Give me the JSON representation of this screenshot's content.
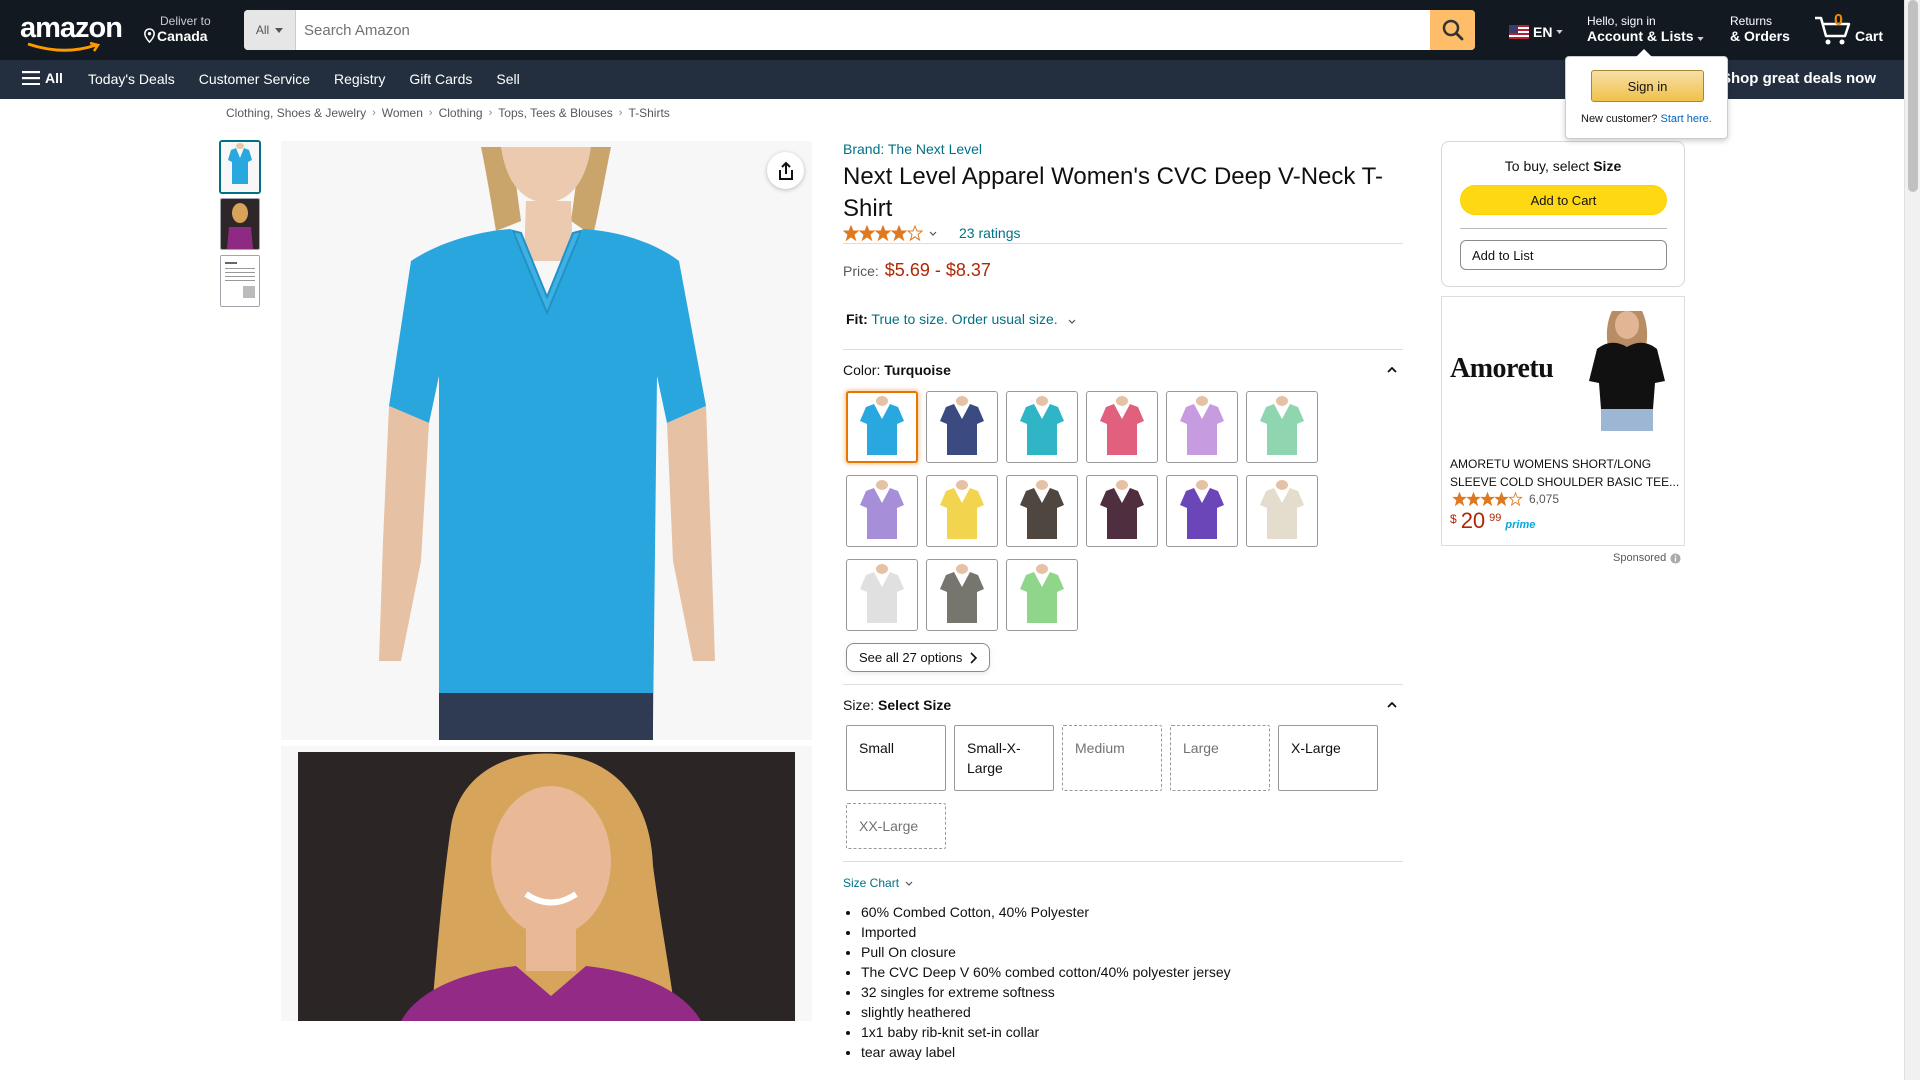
{
  "header": {
    "logo_text": "amazon",
    "deliver_line1": "Deliver to",
    "deliver_line2": "Canada",
    "search_category": "All",
    "search_placeholder": "Search Amazon",
    "language": "EN",
    "account_line1": "Hello, sign in",
    "account_line2": "Account & Lists",
    "returns_line1": "Returns",
    "returns_line2": "& Orders",
    "cart_count": "0",
    "cart_label": "Cart"
  },
  "nav": {
    "all_label": "All",
    "links": [
      "Today's Deals",
      "Customer Service",
      "Registry",
      "Gift Cards",
      "Sell"
    ],
    "promo": "Shop great deals now"
  },
  "flyout": {
    "signin_label": "Sign in",
    "new_customer": "New customer?",
    "start_here": "Start here."
  },
  "breadcrumb": [
    "Clothing, Shoes & Jewelry",
    "Women",
    "Clothing",
    "Tops, Tees & Blouses",
    "T-Shirts"
  ],
  "product": {
    "brand": "Brand: The Next Level",
    "title": "Next Level Apparel Women's CVC Deep V-Neck T-Shirt",
    "ratings": "23 ratings",
    "rating_stars": 4.0,
    "price_label": "Price:",
    "price": "$5.69 - $8.37",
    "fit_label": "Fit:",
    "fit_value": "True to size. Order usual size.",
    "color_label": "Color:",
    "color_value": "Turquoise",
    "colors": [
      "#29a8e0",
      "#3b4b82",
      "#2fb5c6",
      "#e0607e",
      "#c69be0",
      "#8fd6b0",
      "#a68fd8",
      "#f2d44f",
      "#4f4640",
      "#4f2f3f",
      "#6b46b8",
      "#e4dccd",
      "#e0e0e0",
      "#76766e",
      "#8fd68a"
    ],
    "see_all": "See all 27 options",
    "size_label": "Size:",
    "size_value": "Select Size",
    "sizes": [
      {
        "label": "Small",
        "available": true
      },
      {
        "label": "Small-X-Large",
        "available": true
      },
      {
        "label": "Medium",
        "available": false
      },
      {
        "label": "Large",
        "available": false
      },
      {
        "label": "X-Large",
        "available": true
      },
      {
        "label": "XX-Large",
        "available": false
      }
    ],
    "size_chart": "Size Chart",
    "bullets": [
      "60% Combed Cotton, 40% Polyester",
      "Imported",
      "Pull On closure",
      "The CVC Deep V 60% combed cotton/40% polyester jersey",
      "32 singles for extreme softness",
      "slightly heathered",
      "1x1 baby rib-knit set-in collar",
      "tear away label"
    ]
  },
  "buybox": {
    "to_buy_prefix": "To buy, select",
    "to_buy_bold": "Size",
    "add_to_cart": "Add to Cart",
    "add_to_list": "Add to List"
  },
  "ad": {
    "brand": "Amoretu",
    "title": "AMORETU WOMENS SHORT/LONG SLEEVE COLD SHOULDER BASIC TEE...",
    "rating_count": "6,075",
    "price_symbol": "$",
    "price_whole": "20",
    "price_fraction": "99",
    "prime": "prime",
    "sponsored": "Sponsored"
  },
  "colors": {
    "header_bg": "#131921",
    "nav_bg": "#232f3e",
    "search_button": "#febd69",
    "link": "#007185",
    "price": "#b12704",
    "add_to_cart": "#ffd814"
  }
}
